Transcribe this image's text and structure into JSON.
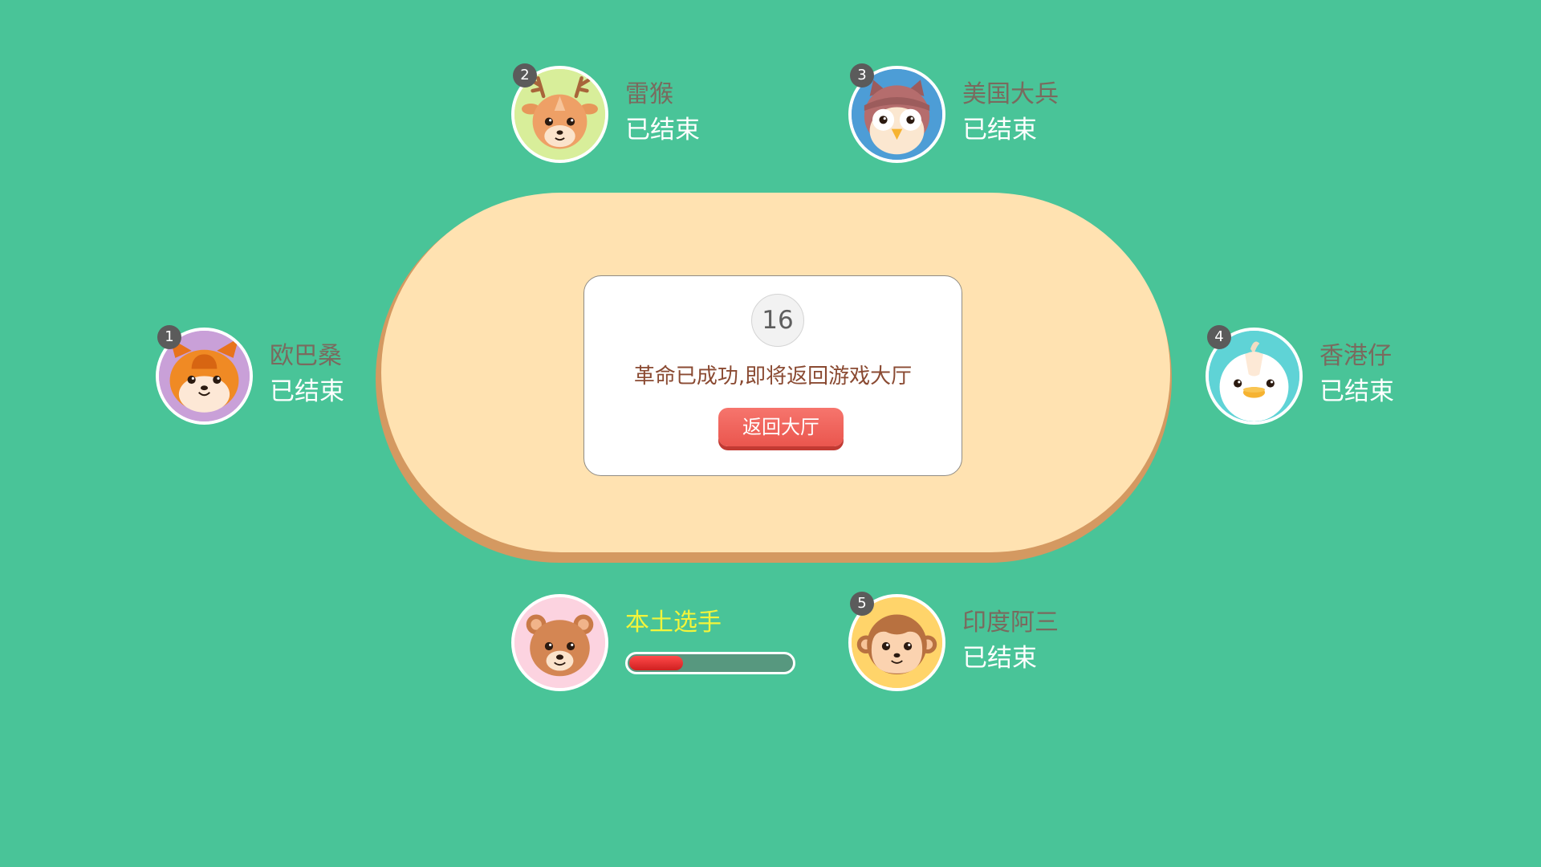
{
  "dialog": {
    "countdown": "16",
    "message": "革命已成功,即将返回游戏大厅",
    "button_label": "返回大厅"
  },
  "players": [
    {
      "seat": "1",
      "name": "欧巴桑",
      "status": "已结束",
      "avatar": "hamster-icon",
      "avatar_bg": "#c9a0d8"
    },
    {
      "seat": "2",
      "name": "雷猴",
      "status": "已结束",
      "avatar": "deer-icon",
      "avatar_bg": "#d8ee9a"
    },
    {
      "seat": "3",
      "name": "美国大兵",
      "status": "已结束",
      "avatar": "owl-icon",
      "avatar_bg": "#4d9dd6"
    },
    {
      "seat": "4",
      "name": "香港仔",
      "status": "已结束",
      "avatar": "duck-icon",
      "avatar_bg": "#5fd3d6"
    },
    {
      "seat": "5",
      "name": "印度阿三",
      "status": "已结束",
      "avatar": "monkey-icon",
      "avatar_bg": "#ffd46a"
    }
  ],
  "self": {
    "name": "本土选手",
    "avatar": "bear-icon",
    "avatar_bg": "#fcd3e0",
    "timer_fraction": 0.33
  },
  "colors": {
    "background": "#49c498",
    "table": "#ffe2b1",
    "table_rim": "#d49961",
    "button": "#ef5f57",
    "timer_fill": "#e62b2b",
    "self_name": "#f3f53a"
  }
}
